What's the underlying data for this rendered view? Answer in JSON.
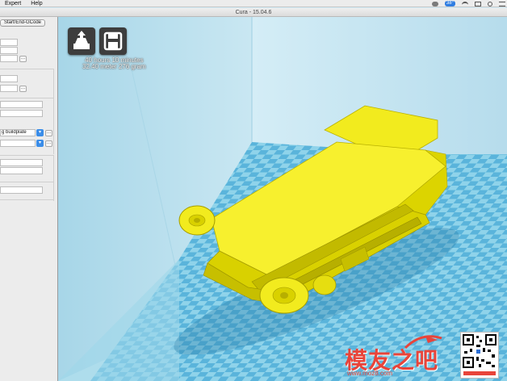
{
  "menu": {
    "items": [
      "Expert",
      "Help"
    ],
    "badge": "38°"
  },
  "window": {
    "title": "Cura - 15.04.6"
  },
  "sidebar": {
    "tab_label": "Start/End-GCode",
    "support_select": "g buildplate"
  },
  "viewport": {
    "print_time": "40 hours 10 minutes",
    "print_material": "32.40 meter 276 gram",
    "load_icon": "load-model-icon",
    "save_icon": "save-floppy-icon"
  },
  "watermark": {
    "text": "模友之吧",
    "url": "www.moz8.com"
  },
  "colors": {
    "model": "#f2eb1e",
    "model_shadow": "#c7bf00",
    "plate_light": "#8fd3ea",
    "plate_dark": "#5ab4db",
    "volume": "#bfe1ee",
    "panel": "#ececec"
  }
}
